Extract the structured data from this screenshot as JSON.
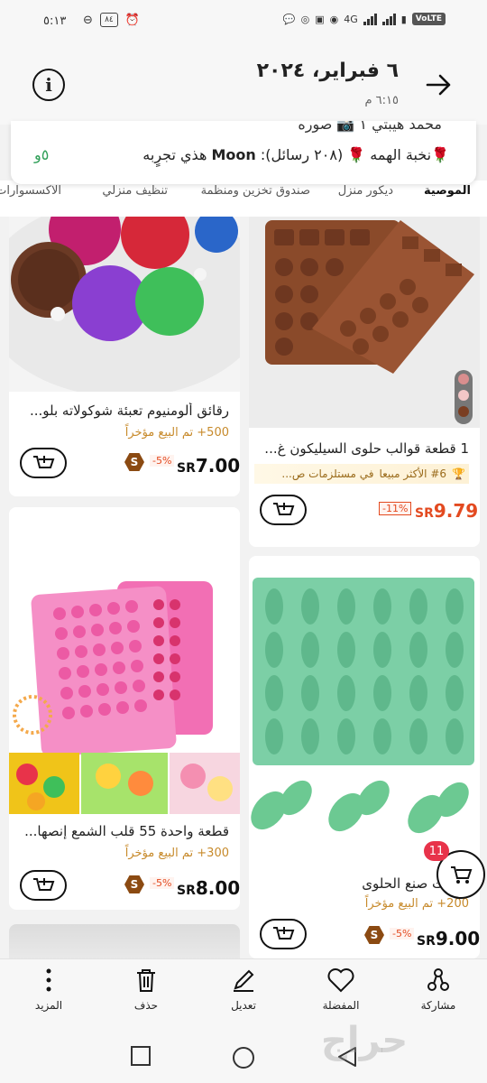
{
  "status_bar": {
    "time": "٥:١٣",
    "network": "4G",
    "volte": "VoLTE",
    "battery": "٨٤"
  },
  "header": {
    "date": "٦ فبراير، ٢٠٢٤",
    "time": "٦:١٥ م"
  },
  "notification": {
    "line1": "محمد هيبتي ١ 📷 صوره",
    "line2_prefix": "🌹نخبة الهمه 🌹 (٢٠٨ رسائل): ",
    "line2_sender": "Moon",
    "line2_suffix": " هذي تجرٍبه",
    "count": "٥و"
  },
  "tabs": [
    "الموصية",
    "ديكور منزل",
    "صندوق تخزين ومنظمة",
    "تنظيف منزلي",
    "الاكسسوارات"
  ],
  "products": [
    {
      "title": "رقائق ألومنيوم تعبئة شوكولاته بلو...",
      "sold": "500+ تم البيع مؤخراً",
      "currency": "SR",
      "price": "7.00",
      "discount": "-5%",
      "badge": "S"
    },
    {
      "title": "1 قطعة قوالب حلوى السيليكون غ...",
      "tag_rank": "#6 الأكثر مبيعا",
      "tag_category": "في مستلزمات ص...",
      "currency": "SR",
      "price": "9.79",
      "discount": "-11%"
    },
    {
      "title": "قطعة واحدة 55 قلب الشمع إنصها...",
      "sold": "300+ تم البيع مؤخراً",
      "currency": "SR",
      "price": "8.00",
      "discount": "-5%",
      "badge": "S"
    },
    {
      "title": "...مات صنع الحلوى",
      "sold": "200+ تم البيع مؤخراً",
      "currency": "SR",
      "price": "9.00",
      "discount": "-5%",
      "badge": "S"
    }
  ],
  "cart": {
    "count": "11"
  },
  "actions": {
    "share": "مشاركة",
    "favorite": "المفضلة",
    "edit": "تعديل",
    "delete": "حذف",
    "more": "المزيد"
  },
  "watermark": "حراج",
  "colors": {
    "price_red": "#e34a20",
    "sold_gold": "#c78a2b",
    "badge_red": "#e8334a",
    "mold_brown": "#8a4a2a",
    "mold_pink": "#f26fb4",
    "mold_green": "#7ccfa6"
  }
}
